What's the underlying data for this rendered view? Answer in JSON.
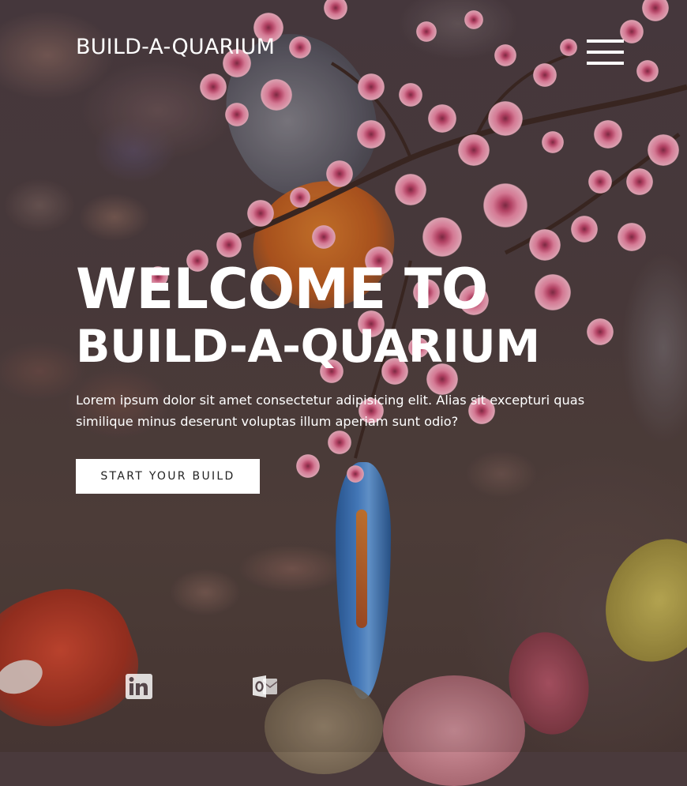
{
  "header": {
    "brand": "BUILD-A-QUARIUM",
    "menu_icon": "hamburger-menu-icon"
  },
  "hero": {
    "title_line1": "WELCOME TO",
    "title_line2": "BUILD-A-QUARIUM",
    "description": "Lorem ipsum dolor sit amet consectetur adipisicing elit. Alias sit excepturi quas similique minus deserunt voluptas illum aperiam sunt odio?",
    "cta_label": "START YOUR BUILD"
  },
  "social": [
    {
      "icon": "linkedin-icon"
    },
    {
      "icon": "outlook-icon"
    }
  ],
  "colors": {
    "text": "#ffffff",
    "button_bg": "#ffffff",
    "button_text": "#222222"
  }
}
